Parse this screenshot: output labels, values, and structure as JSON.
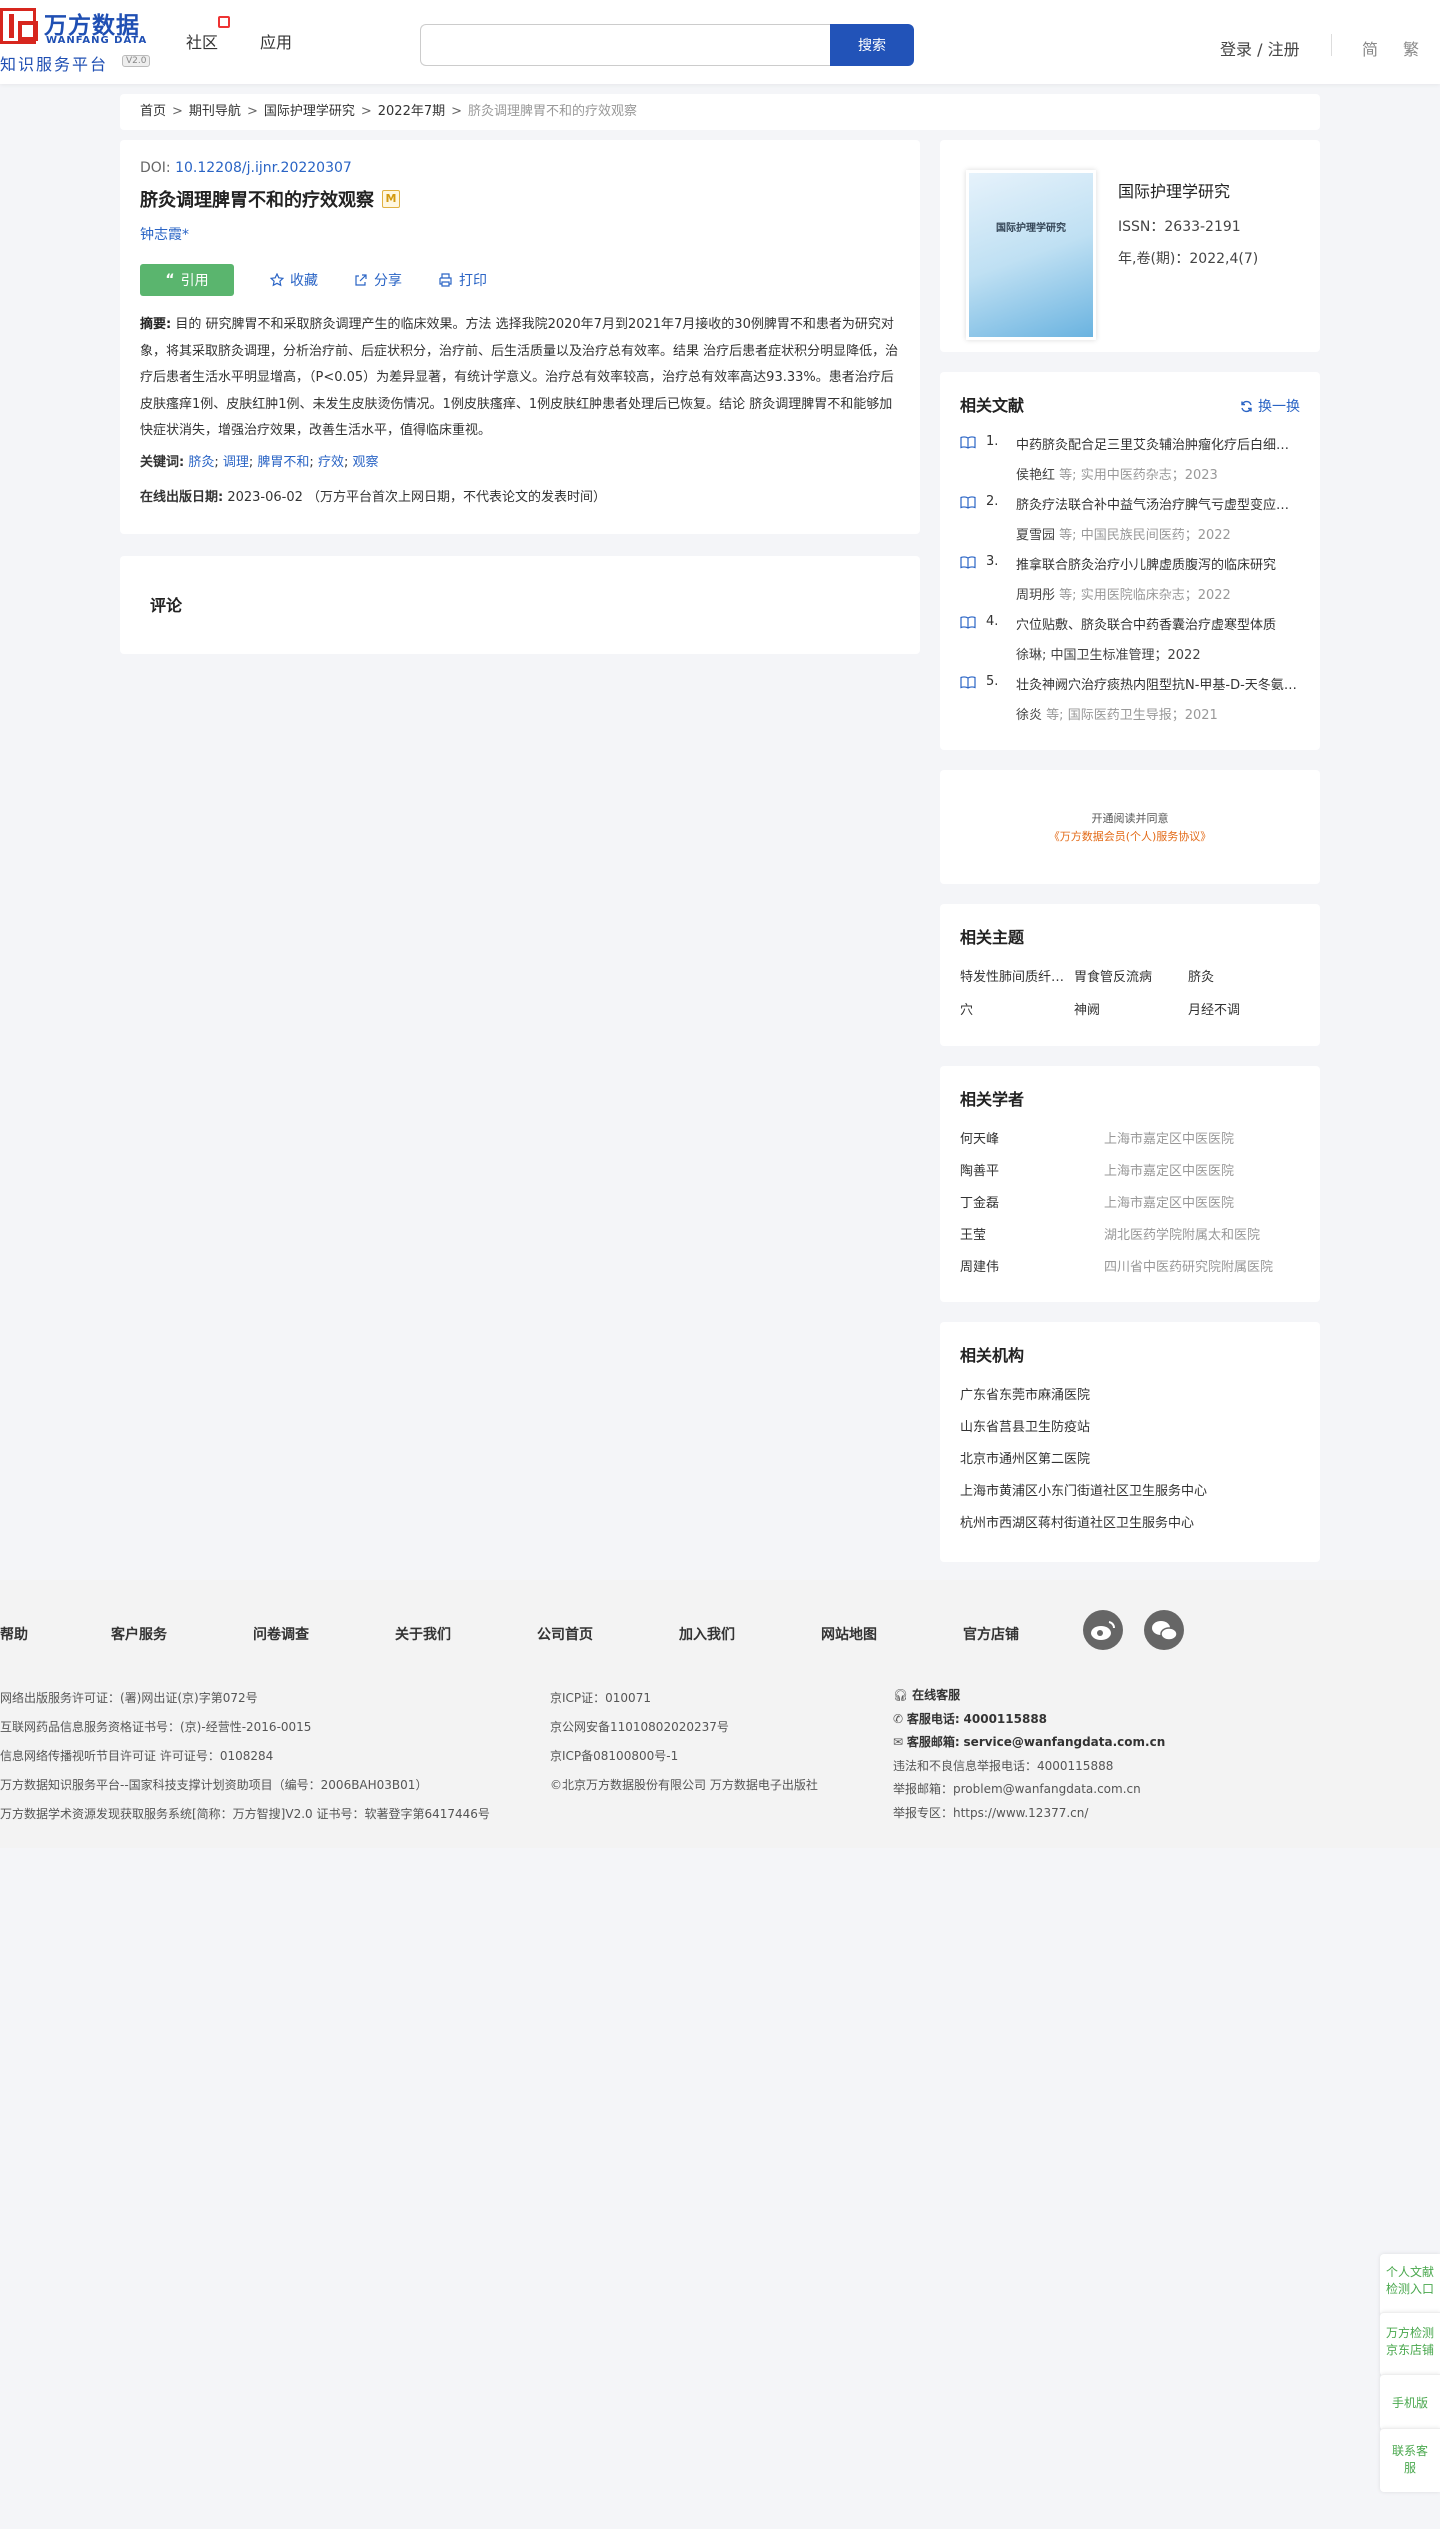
{
  "header": {
    "logo_cn": "万方数据",
    "logo_en": "WANFANG DATA",
    "logo_sub": "知识服务平台",
    "logo_ver": "V2.0",
    "nav": [
      "社区",
      "应用"
    ],
    "search_placeholder": "",
    "search_label": "搜索",
    "login_label": "登录 / 注册",
    "lang_simple": "简",
    "lang_trad": "繁"
  },
  "breadcrumb": {
    "items": [
      "首页",
      "期刊导航",
      "国际护理学研究",
      "2022年7期"
    ],
    "current": "脐灸调理脾胃不和的疗效观察"
  },
  "article": {
    "doi_label": "DOI:",
    "doi": "10.12208/j.ijnr.20220307",
    "title": "脐灸调理脾胃不和的疗效观察",
    "badge": "M",
    "author": "钟志霞*",
    "cite_label": "引用",
    "fav_label": "收藏",
    "share_label": "分享",
    "print_label": "打印",
    "abstract_label": "摘要:",
    "abstract": " 目的 研究脾胃不和采取脐灸调理产生的临床效果。方法 选择我院2020年7月到2021年7月接收的30例脾胃不和患者为研究对象，将其采取脐灸调理，分析治疗前、后症状积分，治疗前、后生活质量以及治疗总有效率。结果 治疗后患者症状积分明显降低，治疗后患者生活水平明显增高，（P<0.05）为差异显著，有统计学意义。治疗总有效率较高，治疗总有效率高达93.33%。患者治疗后皮肤瘙痒1例、皮肤红肿1例、未发生皮肤烫伤情况。1例皮肤瘙痒、1例皮肤红肿患者处理后已恢复。结论 脐灸调理脾胃不和能够加快症状消失，增强治疗效果，改善生活水平，值得临床重视。",
    "keywords_label": "关键词:",
    "keywords": [
      "脐灸",
      "调理",
      "脾胃不和",
      "疗效",
      "观察"
    ],
    "pubdate_label": "在线出版日期:",
    "pubdate": "2023-06-02",
    "pubdate_note": "（万方平台首次上网日期，不代表论文的发表时间）"
  },
  "comment": {
    "title": "评论"
  },
  "journal": {
    "cover_text": "国际护理学研究",
    "name": "国际护理学研究",
    "issn": "ISSN：2633-2191",
    "vol": "年,卷(期)：2022,4(7)"
  },
  "related_docs": {
    "title": "相关文献",
    "swap_label": "换一换",
    "items": [
      {
        "num": "1.",
        "title": "中药脐灸配合足三里艾灸辅治肿瘤化疗后白细胞减少症",
        "authors": "侯艳红",
        "suffix": "等;",
        "source": "实用中医药杂志；2023"
      },
      {
        "num": "2.",
        "title": "脐灸疗法联合补中益气汤治疗脾气亏虚型变应性鼻炎",
        "authors": "夏雪园",
        "suffix": "等;",
        "source": "中国民族民间医药；2022"
      },
      {
        "num": "3.",
        "title": "推拿联合脐灸治疗小儿脾虚质腹泻的临床研究",
        "authors": "周玥彤",
        "suffix": "等;",
        "source": "实用医院临床杂志；2022"
      },
      {
        "num": "4.",
        "title": "穴位贴敷、脐灸联合中药香囊治疗虚寒型体质",
        "authors": "徐琳; 中国卫生标准管理；2022",
        "suffix": "",
        "source": ""
      },
      {
        "num": "5.",
        "title": "壮灸神阙穴治疗痰热内阻型抗N-甲基-D-天冬氨酸受体脑炎",
        "authors": "徐炎",
        "suffix": "等;",
        "source": "国际医药卫生导报；2021"
      }
    ]
  },
  "notice": {
    "line1": "开通阅读并同意",
    "line2": "《万方数据会员(个人)服务协议》"
  },
  "topics": {
    "title": "相关主题",
    "items": [
      "特发性肺间质纤维化",
      "胃食管反流病",
      "脐灸",
      "穴",
      "神阙",
      "月经不调"
    ]
  },
  "scholars": {
    "title": "相关学者",
    "items": [
      {
        "name": "何天峰",
        "org": "上海市嘉定区中医医院"
      },
      {
        "name": "陶善平",
        "org": "上海市嘉定区中医医院"
      },
      {
        "name": "丁金磊",
        "org": "上海市嘉定区中医医院"
      },
      {
        "name": "王莹",
        "org": "湖北医药学院附属太和医院"
      },
      {
        "name": "周建伟",
        "org": "四川省中医药研究院附属医院"
      }
    ]
  },
  "orgs": {
    "title": "相关机构",
    "items": [
      "广东省东莞市麻涌医院",
      "山东省莒县卫生防疫站",
      "北京市通州区第二医院",
      "上海市黄浦区小东门街道社区卫生服务中心",
      "杭州市西湖区蒋村街道社区卫生服务中心"
    ]
  },
  "footer": {
    "nav": [
      "帮助",
      "客户服务",
      "问卷调查",
      "关于我们",
      "公司首页",
      "加入我们",
      "网站地图",
      "官方店铺"
    ],
    "col1": [
      "网络出版服务许可证：(署)网出证(京)字第072号",
      "互联网药品信息服务资格证书号：(京)-经营性-2016-0015",
      "信息网络传播视听节目许可证 许可证号：0108284",
      "万方数据知识服务平台--国家科技支撑计划资助项目（编号：2006BAH03B01）",
      "万方数据学术资源发现获取服务系统[简称：万方智搜]V2.0 证书号：软著登字第6417446号"
    ],
    "col2": [
      "京ICP证：010071",
      "京公网安备11010802020237号",
      "京ICP备08100800号-1",
      "©北京万方数据股份有限公司 万方数据电子出版社"
    ],
    "col3": {
      "online_service": "在线客服",
      "phone_label": "客服电话:",
      "phone": "4000115888",
      "email_label": "客服邮箱:",
      "email": "service@wanfangdata.com.cn",
      "report_phone": "违法和不良信息举报电话：4000115888",
      "report_email": "举报邮箱：problem@wanfangdata.com.cn",
      "report_site": "举报专区：https://www.12377.cn/"
    }
  },
  "side": {
    "item1": "个人文献检测入口",
    "item2": "万方检测京东店铺",
    "item3": "手机版",
    "item4": "联系客服"
  }
}
